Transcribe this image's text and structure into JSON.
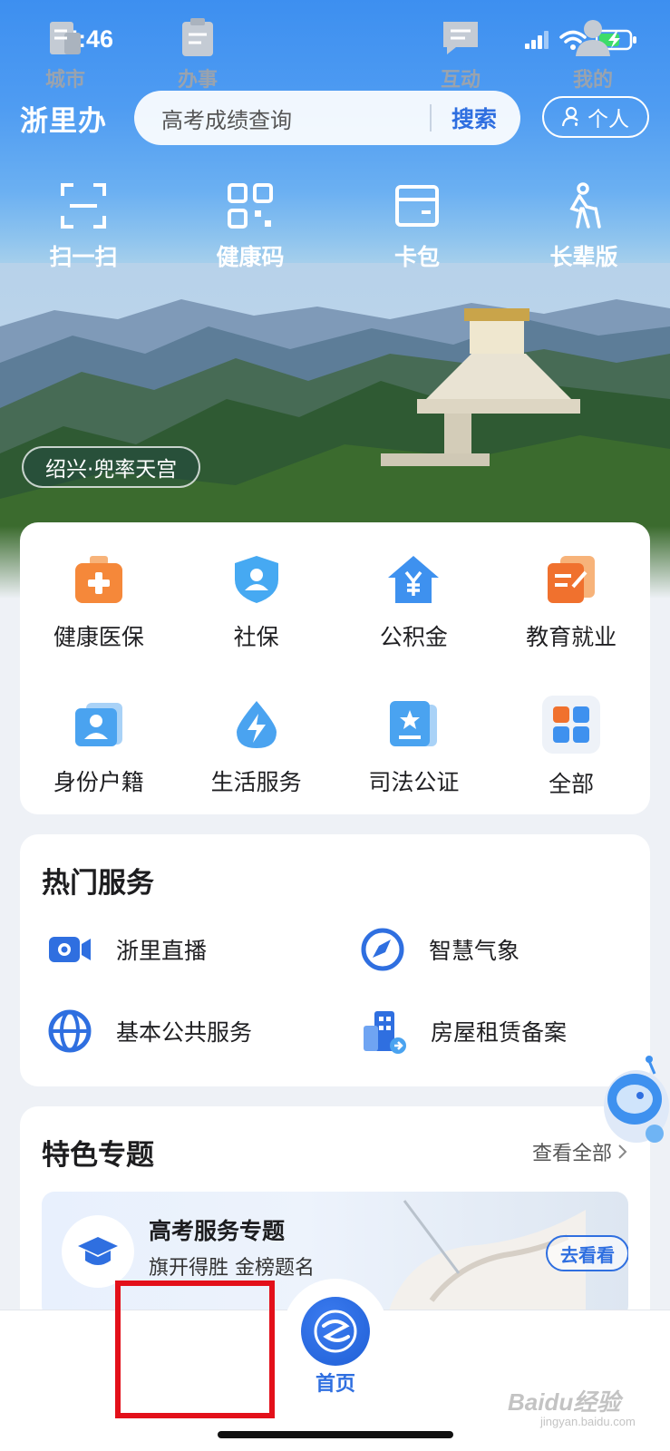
{
  "status_bar": {
    "time": "15:46"
  },
  "header": {
    "app_name": "浙里办",
    "search_placeholder": "高考成绩查询",
    "search_button": "搜索",
    "personal_button": "个人"
  },
  "quick_actions": [
    {
      "label": "扫一扫",
      "icon": "scan-icon"
    },
    {
      "label": "健康码",
      "icon": "qr-code-icon"
    },
    {
      "label": "卡包",
      "icon": "card-wallet-icon"
    },
    {
      "label": "长辈版",
      "icon": "elder-mode-icon"
    }
  ],
  "location_tag": "绍兴·兜率天宫",
  "categories": [
    {
      "label": "健康医保",
      "icon": "medical-kit-icon"
    },
    {
      "label": "社保",
      "icon": "shield-user-icon"
    },
    {
      "label": "公积金",
      "icon": "house-yuan-icon"
    },
    {
      "label": "教育就业",
      "icon": "education-icon"
    },
    {
      "label": "身份户籍",
      "icon": "id-card-icon"
    },
    {
      "label": "生活服务",
      "icon": "lightning-drop-icon"
    },
    {
      "label": "司法公证",
      "icon": "notary-icon"
    },
    {
      "label": "全部",
      "icon": "grid-all-icon"
    }
  ],
  "hot_services": {
    "title": "热门服务",
    "items": [
      {
        "label": "浙里直播",
        "icon": "live-camera-icon"
      },
      {
        "label": "智慧气象",
        "icon": "compass-icon"
      },
      {
        "label": "基本公共服务",
        "icon": "globe-icon"
      },
      {
        "label": "房屋租赁备案",
        "icon": "building-icon"
      }
    ]
  },
  "special_topics": {
    "title": "特色专题",
    "view_all": "查看全部",
    "banner": {
      "title": "高考服务专题",
      "subtitle": "旗开得胜 金榜题名",
      "button": "去看看"
    }
  },
  "tabbar": {
    "items": [
      {
        "label": "城市"
      },
      {
        "label": "办事"
      },
      {
        "label": "首页"
      },
      {
        "label": "互动"
      },
      {
        "label": "我的"
      }
    ]
  },
  "watermark": {
    "text": "Baidu经验",
    "sub": "jingyan.baidu.com"
  },
  "colors": {
    "accent": "#2f6fe0",
    "highlight": "#e3101a",
    "page_bg": "#eef1f6"
  }
}
